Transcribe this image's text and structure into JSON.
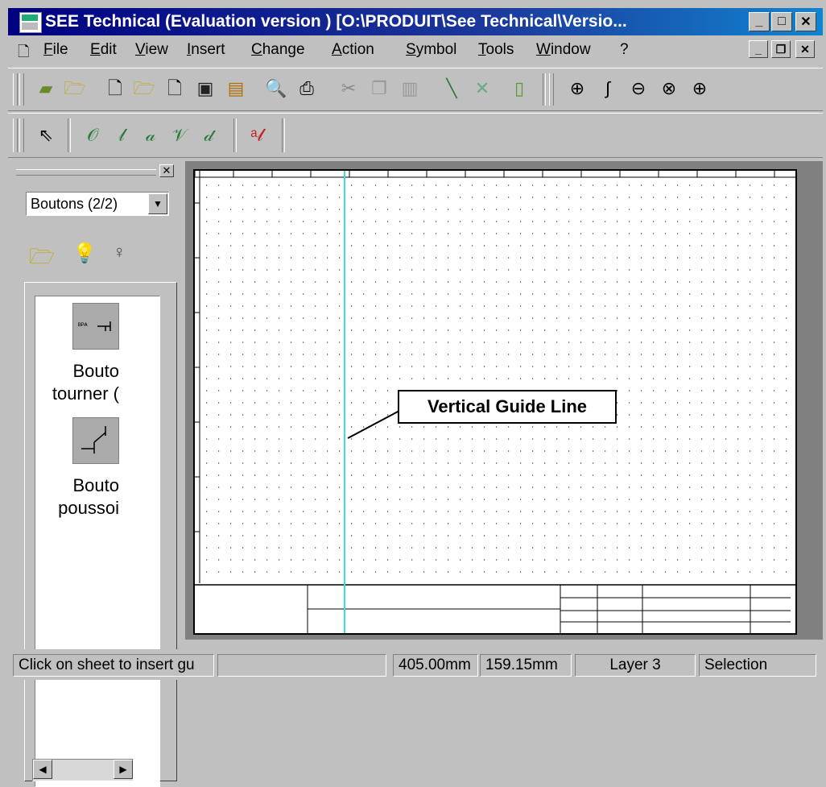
{
  "window": {
    "title": "SEE Technical (Evaluation version ) [O:\\PRODUIT\\See Technical\\Versio...",
    "controls": [
      "minimize",
      "maximize",
      "close"
    ]
  },
  "menu": {
    "items": [
      "File",
      "Edit",
      "View",
      "Insert",
      "Change",
      "Action",
      "Symbol",
      "Tools",
      "Window",
      "?"
    ]
  },
  "toolbar_main": {
    "buttons": [
      "new-project-icon",
      "open-project-icon",
      "new-sheet-icon",
      "open-sheet-icon",
      "sheet-info-icon",
      "save-icon",
      "save-all-icon",
      "print-preview-icon",
      "print-icon",
      "cut-icon",
      "copy-icon",
      "paste-icon",
      "pen-icon",
      "eraser-icon",
      "exit-door-icon",
      "zoom-icon",
      "zoom-pen-icon",
      "zoom-out-icon",
      "zoom-window-icon",
      "zoom-in-icon"
    ]
  },
  "toolbar_draw": {
    "buttons": [
      "select-arrow-icon",
      "draw-circle-pen-icon",
      "draw-pen-icon",
      "draw-label-pen-icon",
      "draw-multi-pen-icon",
      "draw-plus-pen-icon",
      "text-pen-icon"
    ]
  },
  "panel": {
    "combo_value": "Boutons (2/2)",
    "icons": [
      "open-folder-icon",
      "bulb-on-icon",
      "bulb-off-icon"
    ],
    "symbols": [
      {
        "icon": "turn-button-symbol-icon",
        "line1": "Bouto",
        "line2": "tourner ("
      },
      {
        "icon": "push-button-symbol-icon",
        "line1": "Bouto",
        "line2": "poussoi"
      }
    ]
  },
  "canvas": {
    "callout": "Vertical Guide Line",
    "guide_color": "#40e0d0"
  },
  "statusbar": {
    "hint": "Click on sheet to insert gu",
    "x_coord": "405.00mm",
    "y_coord": "159.15mm",
    "layer": "Layer 3",
    "mode": "Selection"
  }
}
